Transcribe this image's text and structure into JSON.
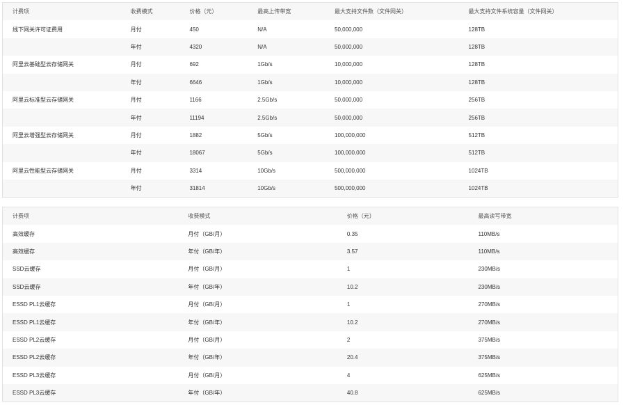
{
  "gateway_table": {
    "headers": [
      "计费项",
      "收费模式",
      "价格（元）",
      "最高上传带宽",
      "最大支持文件数（文件网关）",
      "最大支持文件系统容量（文件网关）"
    ],
    "rows": [
      [
        "线下网关许可证费用",
        "月付",
        "450",
        "N/A",
        "50,000,000",
        "128TB"
      ],
      [
        "",
        "年付",
        "4320",
        "N/A",
        "50,000,000",
        "128TB"
      ],
      [
        "阿里云基础型云存储网关",
        "月付",
        "692",
        "1Gb/s",
        "10,000,000",
        "128TB"
      ],
      [
        "",
        "年付",
        "6646",
        "1Gb/s",
        "10,000,000",
        "128TB"
      ],
      [
        "阿里云标准型云存储网关",
        "月付",
        "1166",
        "2.5Gb/s",
        "50,000,000",
        "256TB"
      ],
      [
        "",
        "年付",
        "11194",
        "2.5Gb/s",
        "50,000,000",
        "256TB"
      ],
      [
        "阿里云增强型云存储网关",
        "月付",
        "1882",
        "5Gb/s",
        "100,000,000",
        "512TB"
      ],
      [
        "",
        "年付",
        "18067",
        "5Gb/s",
        "100,000,000",
        "512TB"
      ],
      [
        "阿里云性能型云存储网关",
        "月付",
        "3314",
        "10Gb/s",
        "500,000,000",
        "1024TB"
      ],
      [
        "",
        "年付",
        "31814",
        "10Gb/s",
        "500,000,000",
        "1024TB"
      ]
    ]
  },
  "cache_table": {
    "headers": [
      "计费项",
      "收费模式",
      "价格（元）",
      "最高读写带宽"
    ],
    "rows": [
      [
        "高效缓存",
        "月付（GB/月）",
        "0.35",
        "110MB/s"
      ],
      [
        "高效缓存",
        "年付（GB/年）",
        "3.57",
        "110MB/s"
      ],
      [
        "SSD云缓存",
        "月付（GB/月）",
        "1",
        "230MB/s"
      ],
      [
        "SSD云缓存",
        "年付（GB/年）",
        "10.2",
        "230MB/s"
      ],
      [
        "ESSD PL1云缓存",
        "月付（GB/月）",
        "1",
        "270MB/s"
      ],
      [
        "ESSD PL1云缓存",
        "年付（GB/年）",
        "10.2",
        "270MB/s"
      ],
      [
        "ESSD PL2云缓存",
        "月付（GB/月）",
        "2",
        "375MB/s"
      ],
      [
        "ESSD PL2云缓存",
        "年付（GB/年）",
        "20.4",
        "375MB/s"
      ],
      [
        "ESSD PL3云缓存",
        "月付（GB/月）",
        "4",
        "625MB/s"
      ],
      [
        "ESSD PL3云缓存",
        "年付（GB/年）",
        "40.8",
        "625MB/s"
      ]
    ]
  }
}
